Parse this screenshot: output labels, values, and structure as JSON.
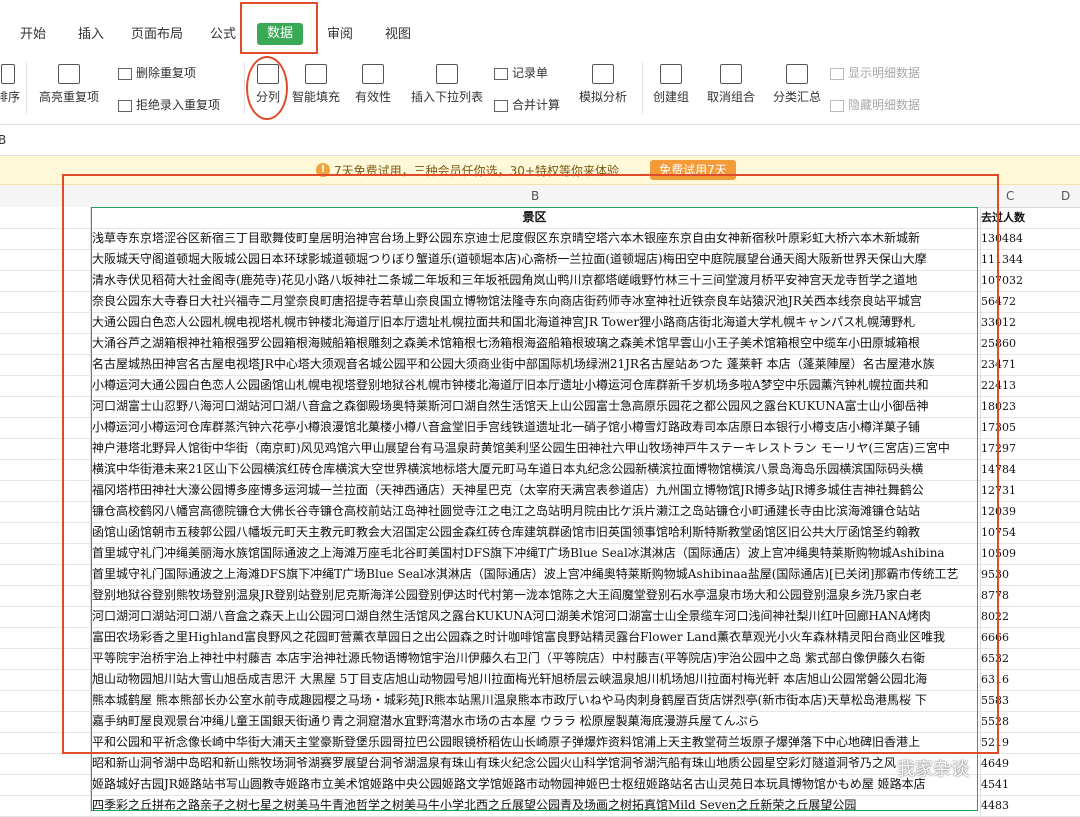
{
  "tabs": {
    "items": [
      "开始",
      "插入",
      "页面布局",
      "公式",
      "数据",
      "审阅",
      "视图"
    ],
    "active": "数据"
  },
  "toolbar": {
    "sort_label": "排序",
    "highlight_dup": "高亮重复项",
    "remove_dup": "删除重复项",
    "reject_dup": "拒绝录入重复项",
    "split": "分列",
    "smart_fill": "智能填充",
    "validity": "有效性",
    "insert_dropdown": "插入下拉列表",
    "record_sheet": "记录单",
    "merge_calc": "合并计算",
    "simulate": "模拟分析",
    "create_group": "创建组",
    "ungroup": "取消组合",
    "subtotal": "分类汇总",
    "show_detail": "显示明细数据",
    "hide_detail": "隐藏明细数据"
  },
  "formula_bar": {
    "name_box": "B"
  },
  "banner": {
    "text": "7天免费试用，三种会员任你选，30+特权等你来体验",
    "button": "免费试用7天"
  },
  "columns": [
    "B",
    "C",
    "D"
  ],
  "table": {
    "header_b": "景区",
    "header_c": "去过人数",
    "rows": [
      {
        "b": "浅草寺东京塔涩谷区新宿三丁目歌舞伎町皇居明治神宫台场上野公园东京迪士尼度假区东京晴空塔六本木银座东京自由女神新宿秋叶原彩虹大桥六本木新城新",
        "c": "130484"
      },
      {
        "b": "大阪城天守阁道顿堀大阪城公园日本环球影城道顿堀つりぼり蟹道乐(道顿堀本店)心斋桥一兰拉面(道顿堀店)梅田空中庭院展望台通天阁大阪新世界天保山大摩",
        "c": "111344"
      },
      {
        "b": "清水寺伏见稻荷大社金阁寺(鹿苑寺)花见小路八坂神社二条城二年坂和三年坂祇园角岚山鸭川京都塔嵯峨野竹林三十三间堂渡月桥平安神宫天龙寺哲学之道地",
        "c": "107032"
      },
      {
        "b": "奈良公园东大寺春日大社兴福寺二月堂奈良町唐招提寺若草山奈良国立博物馆法隆寺东向商店街药师寺冰室神社近铁奈良车站猿沢池JR关西本线奈良站平城宫",
        "c": "56472"
      },
      {
        "b": "大通公园白色恋人公园札幌电视塔札幌市钟楼北海道厅旧本厅遗址札幌拉面共和国北海道神宫JR Tower狸小路商店街北海道大学札幌キャンパス札幌薄野札",
        "c": "33012"
      },
      {
        "b": "大涌谷芦之湖箱根神社箱根强罗公园箱根海贼船箱根雕刻之森美术馆箱根七汤箱根海盗船箱根玻璃之森美术馆早雲山小王子美术馆箱根空中缆车小田原城箱根",
        "c": "25860"
      },
      {
        "b": "名古屋城热田神宫名古屋电视塔JR中心塔大须观音名城公园平和公园大须商业街中部国际机场绿洲21JR名古屋站あつた 蓬莱軒 本店（蓬莱陣屋）名古屋港水族",
        "c": "23471"
      },
      {
        "b": "小樽运河大通公园白色恋人公园函馆山札幌电视塔登别地狱谷札幌市钟楼北海道厅旧本厅遗址小樽运河仓库群新千岁机场多啦A梦空中乐园薰汽钟札幌拉面共和",
        "c": "22413"
      },
      {
        "b": "河口湖富士山忍野八海河口湖站河口湖八音盒之森御殿场奥特莱斯河口湖自然生活馆天上山公园富士急高原乐园花之都公园风之露台KUKUNA富士山小御岳神",
        "c": "18023"
      },
      {
        "b": "小樽运河小樽运河仓库群蒸汽钟六花亭小樽浪漫馆北菓楼小樽八音盒堂旧手宫线铁道遗址北一硝子馆小樽雪灯路政寿司本店原日本银行小樽支店小樽洋菓子铺",
        "c": "17305"
      },
      {
        "b": "神户港塔北野异人馆街中华街（南京町)风见鸡馆六甲山展望台有马温泉莳黄馆美利坚公园生田神社六甲山牧场神戸牛ステーキレストラン モーリヤ(三宮店)三宮中",
        "c": "17297"
      },
      {
        "b": "横滨中华街港未来21区山下公园横滨红砖仓库横滨大空世界横滨地标塔大厦元町马车道日本丸纪念公园新横滨拉面博物馆横滨八景岛海岛乐园横滨国际码头横",
        "c": "14784"
      },
      {
        "b": "福冈塔栉田神社大濠公园博多座博多运河城一兰拉面（天神西通店）天神星巴克（太宰府天满宫表参道店）九州国立博物馆JR博多站JR博多城住吉神社舞鹤公",
        "c": "12731"
      },
      {
        "b": "镰仓高校鹤冈八幡宫高德院镰仓大佛长谷寺镰仓高校前站江岛神社圆觉寺江之电江之岛站明月院由比ケ浜片濑江之岛站镰仓小町通建长寺由比滨海滩镰仓站站",
        "c": "12039"
      },
      {
        "b": "函馆山函馆朝市五稜郭公园八幡坂元町天主教元町教会大沼国定公园金森红砖仓库建筑群函馆市旧英国领事馆哈利斯特斯教堂函馆区旧公共大厅函馆圣约翰教",
        "c": "10754"
      },
      {
        "b": "首里城守礼门冲绳美丽海水族馆国际通波之上海滩万座毛北谷町美国村DFS旗下冲绳T广场Blue Seal冰淇淋店（国际通店）波上宫冲绳奥特莱斯购物城Ashibina",
        "c": "10509"
      },
      {
        "b": "首里城守礼门国际通波之上海滩DFS旗下冲绳T广场Blue Seal冰淇淋店（国际通店）波上宫冲绳奥特莱斯购物城Ashibinaa盐屋(国际通店)[已关闭]那霸市传统工艺",
        "c": "9530"
      },
      {
        "b": "登别地狱谷登别熊牧场登别温泉JR登别站登别尼克斯海洋公园登别伊达时代村第一泷本馆陈之大王阎魔堂登别石水亭温泉市场大和公园登别温泉乡洗乃家白老",
        "c": "8778"
      },
      {
        "b": "河口湖河口湖站河口湖八音盒之森天上山公园河口湖自然生活馆风之露台KUKUNA河口湖美术馆河口湖富士山全景缆车河口浅间神社梨川红叶回廊HANA烤肉",
        "c": "8022"
      },
      {
        "b": "富田农场彩香之里Highland富良野风之花园町营薰衣草园日之出公园森之时计咖啡馆富良野站精灵露台Flower Land薰衣草观光小火车森林精灵阳台商业区唯我",
        "c": "6666"
      },
      {
        "b": "平等院宇治桥宇治上神社中村藤吉 本店宇治神社源氏物语博物馆宇治川伊藤久右卫门（平等院店）中村藤吉(平等院店)宇治公园中之岛 紫式部白像伊藤久右衛",
        "c": "6532"
      },
      {
        "b": "旭山动物园旭川站大雪山旭岳成吉思汗 大黒屋 5丁目支店旭山动物园号旭川拉面梅光轩旭桥层云峡温泉旭川机场旭川拉面村梅光軒 本店旭山公园常磐公园北海",
        "c": "6316"
      },
      {
        "b": "熊本城鹤屋 熊本熊部长办公室水前寺成趣园樱之马场・城彩苑JR熊本站黑川温泉熊本市政厅いねや马肉刺身鹤屋百货店饼烈亭(新市街本店)天草松岛港馬桜 下",
        "c": "5583"
      },
      {
        "b": "嘉手纳町屋良观景台冲绳儿童王国銀天街通り青之洞窟潜水宜野湾潜水市场の古本屋 ウララ 松原屋製菓海底漫游兵屋てんぷら",
        "c": "5528"
      },
      {
        "b": "平和公园和平祈念像长崎中华街大浦天主堂豪斯登堡乐园哥拉巴公园眼镜桥稻佐山长崎原子弹爆炸资料馆浦上天主教堂荷兰坂原子爆弹落下中心地碑旧香港上",
        "c": "5219"
      },
      {
        "b": "昭和新山洞爷湖中岛昭和新山熊牧场洞爷湖赛罗展望台洞爷湖温泉有珠山有珠火纪念公园火山科学馆洞爷湖汽船有珠山地质公园星空彩灯隧道洞爷乃之风",
        "c": "4649"
      },
      {
        "b": "姬路城好古园JR姬路站书写山圆教寺姬路市立美术馆姬路中央公园姬路文学馆姬路市动物园神姬巴士枢纽姬路站名古山灵苑日本玩具博物馆かもめ屋 姬路本店",
        "c": "4541"
      },
      {
        "b": "四季彩之丘拼布之路亲子之树七星之树美马牛青池哲学之树美马牛小学北西之丘展望公园青及场画之树拓真馆Mild Seven之丘新荣之丘展望公园",
        "c": "4483"
      },
      {
        "b": "别府地狱八景海地狱（温泉）别府温泉蒸汽展望台血池地狱（温泉）白池地狱鬼山地狱（温泉）鬼石坊主地狱灶地狱龙卷地狱杉乃井温泉栅汤别府公园别府站",
        "c": "4171"
      },
      {
        "b": "兼六园金泽城东茶屋街近江町市场金泽21世纪美术馆简一 兼六园店武家屋敷尾山神社金泽站西茶屋街长町武家屋敷・野村家近江町・海鲜市场料理 市の蔵铃木",
        "c": "3725"
      }
    ]
  },
  "watermark": "我家杂谈"
}
